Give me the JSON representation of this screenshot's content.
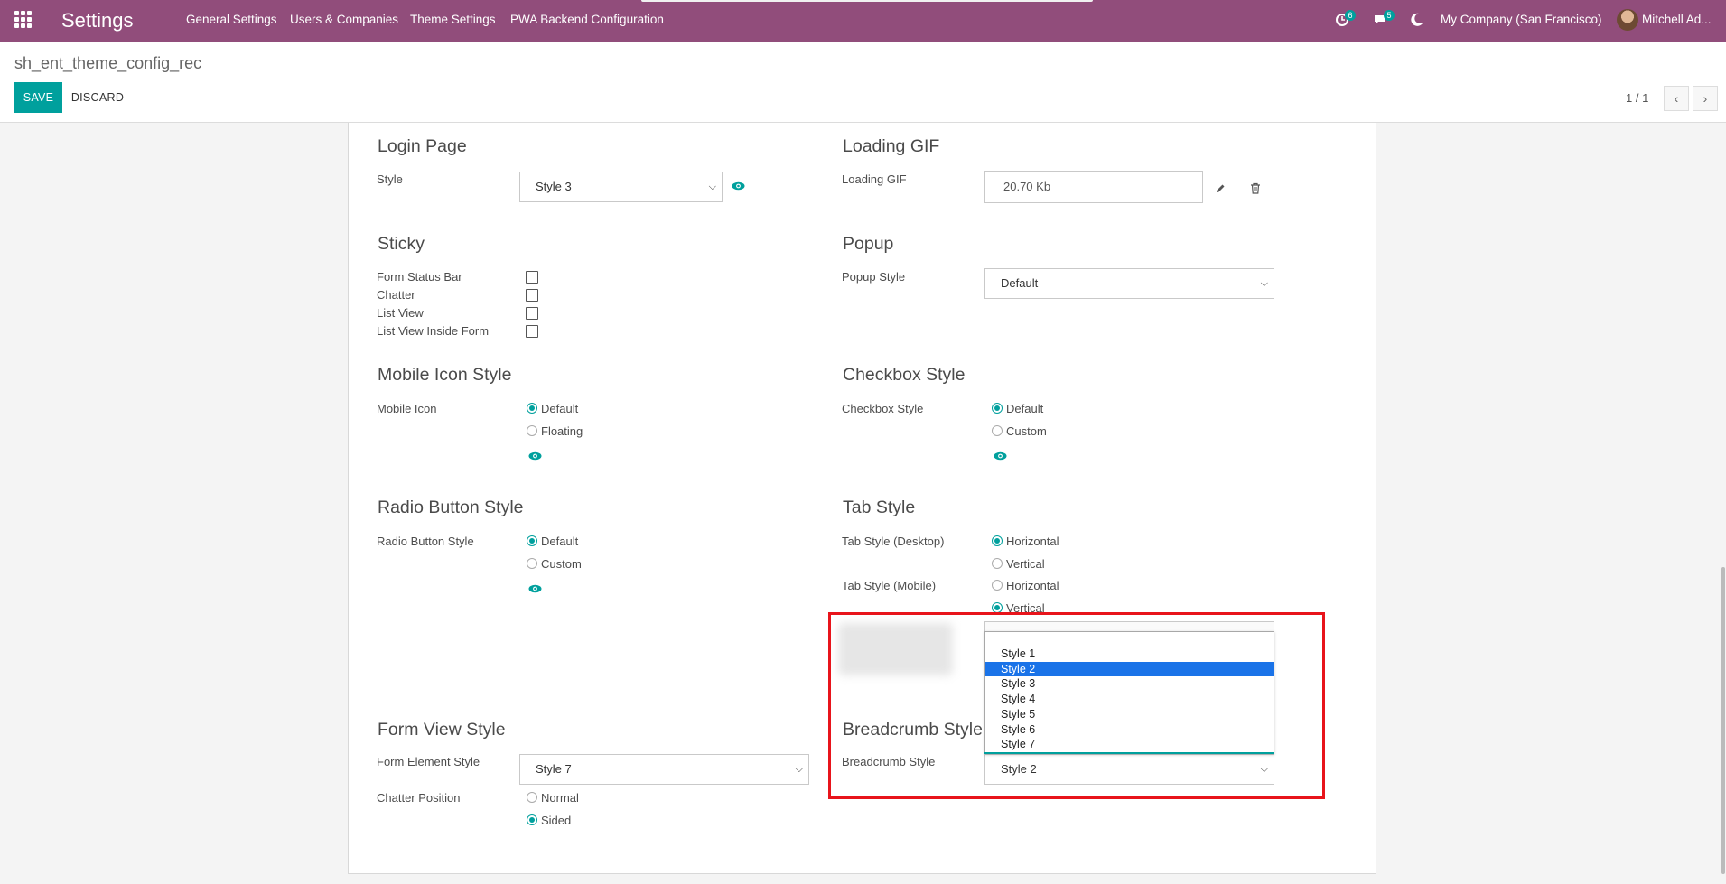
{
  "navbar": {
    "brand": "Settings",
    "menu": [
      "General Settings",
      "Users & Companies",
      "Theme Settings",
      "PWA Backend Configuration"
    ],
    "activity_badge": "6",
    "messages_badge": "5",
    "company": "My Company (San Francisco)",
    "user": "Mitchell Ad...",
    "color": "#914d7b"
  },
  "control": {
    "record_title": "sh_ent_theme_config_rec",
    "save": "SAVE",
    "discard": "DISCARD",
    "pager": "1 / 1"
  },
  "login": {
    "title": "Login Page",
    "style_label": "Style",
    "style_value": "Style 3"
  },
  "loading": {
    "title": "Loading GIF",
    "label": "Loading GIF",
    "value": "20.70 Kb"
  },
  "sticky": {
    "title": "Sticky",
    "items": [
      "Form Status Bar",
      "Chatter",
      "List View",
      "List View Inside Form"
    ],
    "checked": [
      false,
      false,
      false,
      false
    ]
  },
  "popup": {
    "title": "Popup",
    "label": "Popup Style",
    "value": "Default"
  },
  "mobile_icon": {
    "title": "Mobile Icon Style",
    "label": "Mobile Icon",
    "options": [
      "Default",
      "Floating"
    ],
    "selected": "Default"
  },
  "checkbox_style": {
    "title": "Checkbox Style",
    "label": "Checkbox Style",
    "options": [
      "Default",
      "Custom"
    ],
    "selected": "Default"
  },
  "radio_style": {
    "title": "Radio Button Style",
    "label": "Radio Button Style",
    "options": [
      "Default",
      "Custom"
    ],
    "selected": "Default"
  },
  "tab_style": {
    "title": "Tab Style",
    "desktop_label": "Tab Style (Desktop)",
    "desktop_options": [
      "Horizontal",
      "Vertical"
    ],
    "desktop_selected": "Horizontal",
    "mobile_label": "Tab Style (Mobile)",
    "mobile_options": [
      "Horizontal",
      "Vertical"
    ],
    "mobile_selected": "Vertical"
  },
  "form_view": {
    "title": "Form View Style",
    "element_label": "Form Element Style",
    "element_value": "Style 7",
    "chatter_label": "Chatter Position",
    "chatter_options": [
      "Normal",
      "Sided"
    ],
    "chatter_selected": "Sided"
  },
  "breadcrumb": {
    "title": "Breadcrumb Style",
    "label": "Breadcrumb Style",
    "value": "Style 2",
    "dropdown_options": [
      "Style 1",
      "Style 2",
      "Style 3",
      "Style 4",
      "Style 5",
      "Style 6",
      "Style 7"
    ],
    "dropdown_selected": "Style 2"
  },
  "colors": {
    "accent": "#00a09d",
    "highlight": "#e8141b",
    "option_selected": "#1a73e8"
  }
}
